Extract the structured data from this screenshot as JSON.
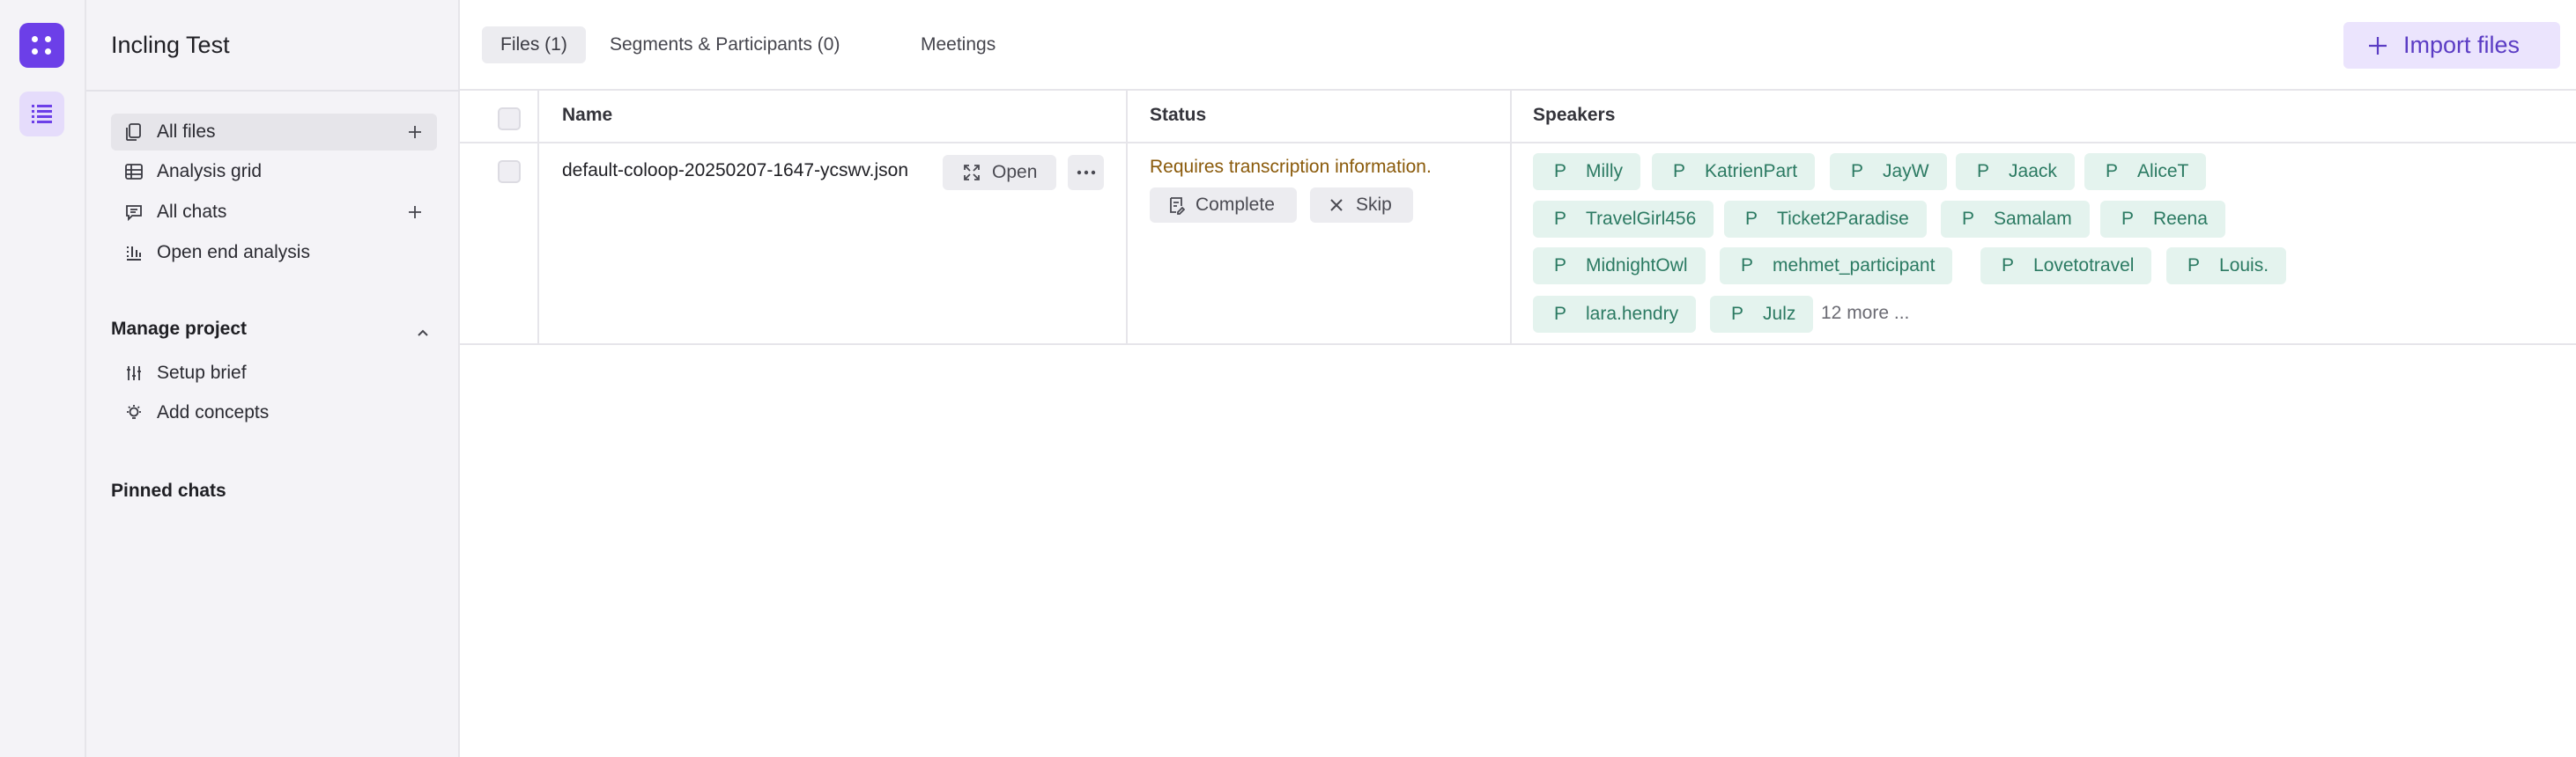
{
  "project": {
    "title": "Incling Test"
  },
  "sidebar": {
    "items": [
      {
        "label": "All files",
        "icon": "files-icon",
        "has_add": true,
        "active": true
      },
      {
        "label": "Analysis grid",
        "icon": "table-icon",
        "has_add": false,
        "active": false
      },
      {
        "label": "All chats",
        "icon": "chat-icon",
        "has_add": true,
        "active": false
      },
      {
        "label": "Open end analysis",
        "icon": "bars-icon",
        "has_add": false,
        "active": false
      }
    ],
    "manage": {
      "heading": "Manage project",
      "items": [
        {
          "label": "Setup brief",
          "icon": "sliders-icon"
        },
        {
          "label": "Add concepts",
          "icon": "lightbulb-icon"
        }
      ]
    },
    "pinned_heading": "Pinned chats"
  },
  "tabs": [
    {
      "label": "Files (1)",
      "active": true
    },
    {
      "label": "Segments & Participants (0)",
      "active": false
    },
    {
      "label": "Meetings",
      "active": false
    }
  ],
  "import_button": {
    "label": "Import files"
  },
  "table": {
    "columns": [
      "Name",
      "Status",
      "Speakers"
    ],
    "row": {
      "filename": "default-coloop-20250207-1647-ycswv.json",
      "open_label": "Open",
      "status": "Requires transcription information.",
      "complete_label": "Complete",
      "skip_label": "Skip",
      "speakers": [
        "Milly",
        "KatrienPart",
        "JayW",
        "Jaack",
        "AliceT",
        "TravelGirl456",
        "Ticket2Paradise",
        "Samalam",
        "Reena",
        "MidnightOwl",
        "mehmet_participant",
        "Lovetotravel",
        "Louis.",
        "lara.hendry",
        "Julz"
      ],
      "speaker_prefix": "P",
      "more_label": "12 more ..."
    }
  },
  "colors": {
    "accent": "#6c3fe8",
    "chip_bg": "#e4f3ee",
    "chip_text": "#2b7a62",
    "warning_text": "#8a5a0a"
  }
}
